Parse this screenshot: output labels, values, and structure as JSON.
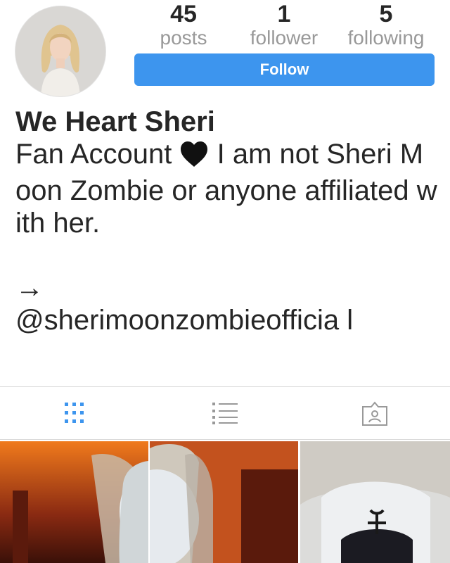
{
  "profile": {
    "avatar_icon": "profile-photo",
    "display_name": "We Heart Sheri",
    "bio": "Fan Account   I am not Sheri Moon Zombie or anyone affiliated with her.\n\n→\n@sherimoonzombieofficial",
    "bio_part1": "Fan Account ",
    "bio_part2": " I am not Sheri Moon Zombie or anyone affiliated with her.\n\n→\n@sherimoonzombieofficia l"
  },
  "stats": {
    "posts": {
      "value": "45",
      "label": "posts"
    },
    "followers": {
      "value": "1",
      "label": "follower"
    },
    "following": {
      "value": "5",
      "label": "following"
    }
  },
  "follow_button": {
    "label": "Follow"
  },
  "tabs": [
    {
      "icon": "grid-icon",
      "active": true
    },
    {
      "icon": "list-icon",
      "active": false
    },
    {
      "icon": "tagged-icon",
      "active": false
    }
  ],
  "colors": {
    "accent": "#3d95ee",
    "text": "#262626",
    "muted": "#999999",
    "inactive_icon": "#999999",
    "divider": "#dbdbdb"
  }
}
